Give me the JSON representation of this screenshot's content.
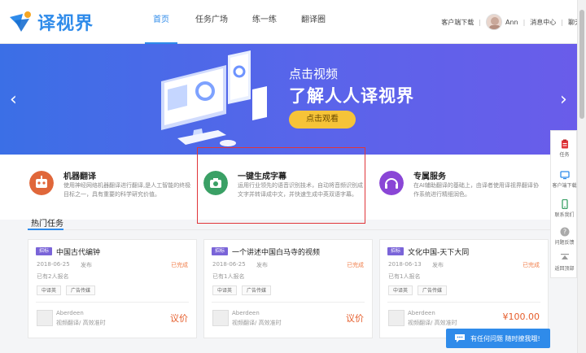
{
  "header": {
    "logo_text": "译视界",
    "nav": [
      "首页",
      "任务广场",
      "练一练",
      "翻译圈"
    ],
    "download": "客户端下载",
    "username": "Ann",
    "messages": "消息中心",
    "chat": "聊天"
  },
  "banner": {
    "subtitle": "点击视频",
    "title": "了解人人译视界",
    "button": "点击观看",
    "prev_icon": "chevron-left-icon",
    "next_icon": "chevron-right-icon"
  },
  "features": [
    {
      "title": "机器翻译",
      "desc": "使用神经网络机器翻译进行翻译,是人工智能的终极目标之一，具有重要的科学研究价值。",
      "color": "#e0673a",
      "icon": "robot-icon"
    },
    {
      "title": "一键生成字幕",
      "desc": "运用行业领先的语音识别技术，自动将音频识别成文字并转译成中文，并快速生成中英双语字幕。",
      "color": "#3aa065",
      "icon": "camera-icon"
    },
    {
      "title": "专属服务",
      "desc": "在AI辅助翻译的基础上，由译者使用译视界翻译协作系统进行精细润色。",
      "color": "#8a46d6",
      "icon": "headset-icon"
    }
  ],
  "hot": {
    "title": "热门任务"
  },
  "cards": [
    {
      "tag": "招标",
      "title": "中国古代编钟",
      "date": "2018-06-25",
      "pub": "发布",
      "status": "已完成",
      "count": "已有2人报名",
      "tags": [
        "中译英",
        "广告传媒"
      ],
      "user": "Aberdeen",
      "user_desc": "视频翻译/ 高效准时",
      "price": "议价"
    },
    {
      "tag": "招标",
      "title": "一个讲述中国白马寺的视频",
      "date": "2018-06-25",
      "pub": "发布",
      "status": "已完成",
      "count": "已有1人报名",
      "tags": [
        "中译英",
        "广告传媒"
      ],
      "user": "Aberdeen",
      "user_desc": "视频翻译/ 高效准时",
      "price": "议价"
    },
    {
      "tag": "招标",
      "title": "文化中国-天下大同",
      "date": "2018-06-13",
      "pub": "发布",
      "status": "已完成",
      "count": "已有1人报名",
      "tags": [
        "中译英",
        "广告传媒"
      ],
      "user": "Aberdeen",
      "user_desc": "视频翻译/ 高效准时",
      "price": "¥100.00"
    }
  ],
  "sidebar": [
    {
      "label": "任务",
      "icon": "clipboard-icon",
      "color": "#e0353a"
    },
    {
      "label": "客户端下载",
      "icon": "monitor-icon",
      "color": "#2f8bea"
    },
    {
      "label": "联系我们",
      "icon": "phone-icon",
      "color": "#3aa065"
    },
    {
      "label": "问题反馈",
      "icon": "question-icon",
      "color": "#999999"
    },
    {
      "label": "返回顶部",
      "icon": "arrow-up-icon",
      "color": "#999999"
    }
  ],
  "chat_button": "有任何问题 随时撩我哦!",
  "colors": {
    "accent": "#2f8bea",
    "banner": "#4a68e8",
    "price": "#e55d2b"
  }
}
